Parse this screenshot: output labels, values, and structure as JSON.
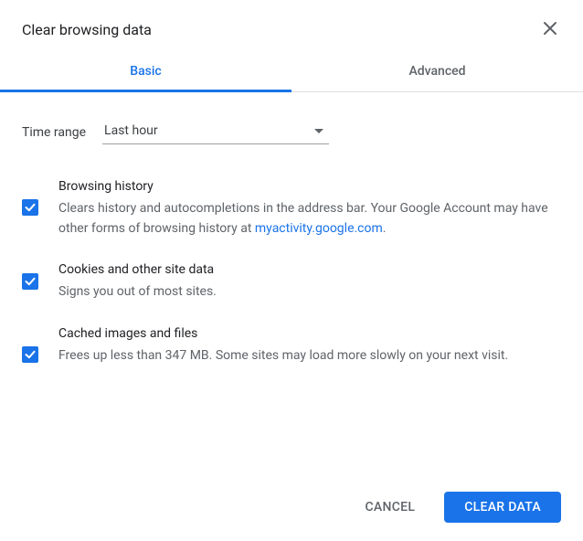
{
  "header": {
    "title": "Clear browsing data"
  },
  "tabs": {
    "basic": "Basic",
    "advanced": "Advanced"
  },
  "timeRange": {
    "label": "Time range",
    "value": "Last hour"
  },
  "options": {
    "browsingHistory": {
      "title": "Browsing history",
      "desc_pre": "Clears history and autocompletions in the address bar. Your Google Account may have other forms of browsing history at ",
      "link": "myactivity.google.com",
      "desc_post": "."
    },
    "cookies": {
      "title": "Cookies and other site data",
      "desc": "Signs you out of most sites."
    },
    "cache": {
      "title": "Cached images and files",
      "desc": "Frees up less than 347 MB. Some sites may load more slowly on your next visit."
    }
  },
  "footer": {
    "cancel": "CANCEL",
    "clear": "CLEAR DATA"
  }
}
